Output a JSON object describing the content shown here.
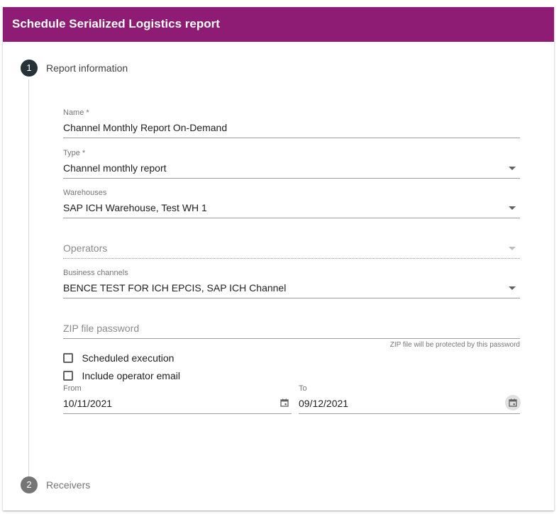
{
  "dialog": {
    "title": "Schedule Serialized Logistics report",
    "header_color": "#8e1b74"
  },
  "steps": [
    {
      "number": "1",
      "label": "Report information"
    },
    {
      "number": "2",
      "label": "Receivers"
    }
  ],
  "form": {
    "name": {
      "label": "Name *",
      "value": "Channel Monthly Report On-Demand"
    },
    "type": {
      "label": "Type *",
      "value": "Channel monthly report"
    },
    "warehouses": {
      "label": "Warehouses",
      "value": "SAP ICH Warehouse, Test WH 1"
    },
    "operators": {
      "placeholder": "Operators"
    },
    "business_channels": {
      "label": "Business channels",
      "value": "BENCE TEST FOR ICH EPCIS, SAP ICH Channel"
    },
    "zip_password": {
      "placeholder": "ZIP file password",
      "hint": "ZIP file will be protected by this password"
    },
    "scheduled_execution": {
      "label": "Scheduled execution",
      "checked": false
    },
    "include_operator_email": {
      "label": "Include operator email",
      "checked": false
    },
    "from": {
      "label": "From",
      "value": "10/11/2021"
    },
    "to": {
      "label": "To",
      "value": "09/12/2021"
    }
  },
  "icons": {
    "dropdown": "chevron-down-icon",
    "calendar": "calendar-icon"
  }
}
